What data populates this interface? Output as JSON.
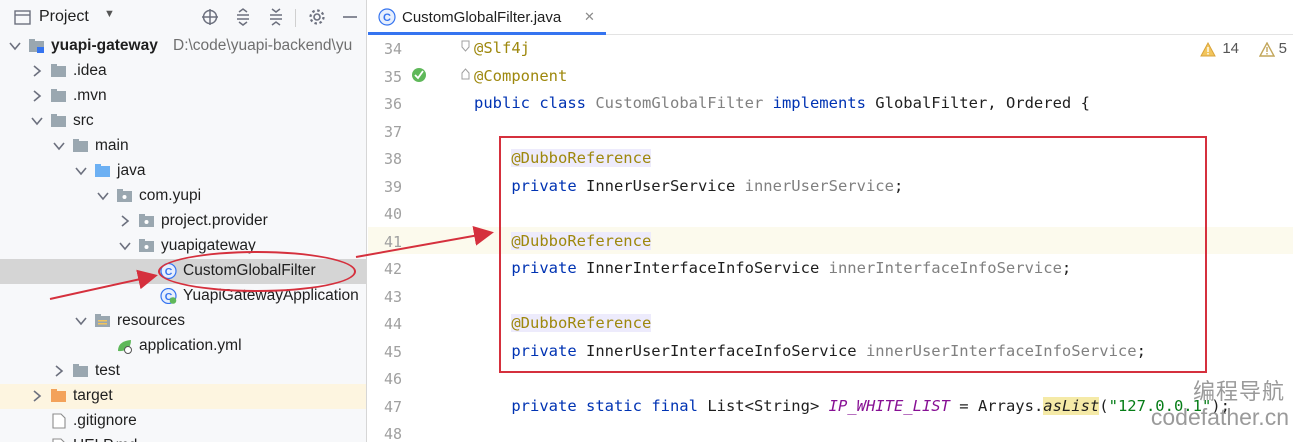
{
  "project_panel": {
    "title": "Project",
    "dropdown_glyph": "▼",
    "toolbar_icons": [
      "crosshair-icon",
      "expand-all-icon",
      "collapse-all-icon",
      "gear-icon",
      "minimize-icon"
    ],
    "tree": [
      {
        "label": "yuapi-gateway",
        "path": "D:\\code\\yuapi-backend\\yu",
        "bold": true,
        "icon": "module-folder-icon",
        "expanded": true
      },
      {
        "label": ".idea",
        "icon": "folder-icon",
        "expanded": false
      },
      {
        "label": ".mvn",
        "icon": "folder-icon",
        "expanded": false
      },
      {
        "label": "src",
        "icon": "folder-icon",
        "expanded": true
      },
      {
        "label": "main",
        "icon": "folder-icon",
        "expanded": true
      },
      {
        "label": "java",
        "icon": "source-folder-icon",
        "expanded": true
      },
      {
        "label": "com.yupi",
        "icon": "package-icon",
        "expanded": true
      },
      {
        "label": "project.provider",
        "icon": "package-icon",
        "expanded": false
      },
      {
        "label": "yuapigateway",
        "icon": "package-icon",
        "expanded": true
      },
      {
        "label": "CustomGlobalFilter",
        "icon": "class-icon",
        "selected": true
      },
      {
        "label": "YuapiGatewayApplication",
        "icon": "spring-class-icon"
      },
      {
        "label": "resources",
        "icon": "resources-folder-icon",
        "expanded": true
      },
      {
        "label": "application.yml",
        "icon": "yml-file-icon"
      },
      {
        "label": "test",
        "icon": "folder-icon",
        "expanded": false
      },
      {
        "label": "target",
        "icon": "excluded-folder-icon",
        "expanded": false
      },
      {
        "label": ".gitignore",
        "icon": "file-icon"
      },
      {
        "label": "HELP.md",
        "icon": "file-icon"
      }
    ]
  },
  "editor": {
    "tab_label": "CustomGlobalFilter.java",
    "tab_close": "✕",
    "inspection": {
      "warnings": "14",
      "weak_warnings": "5"
    },
    "lines": [
      {
        "num": "34",
        "tokens": [
          {
            "t": "@Slf4j",
            "c": "ann"
          }
        ]
      },
      {
        "num": "35",
        "tokens": [
          {
            "t": "@Component",
            "c": "ann"
          }
        ]
      },
      {
        "num": "36",
        "tokens": [
          {
            "t": "public ",
            "c": "kw"
          },
          {
            "t": "class ",
            "c": "kw"
          },
          {
            "t": "CustomGlobalFilter ",
            "c": "cls-gray"
          },
          {
            "t": "implements ",
            "c": "kw"
          },
          {
            "t": "GlobalFilter, Ordered {",
            "c": "type"
          }
        ]
      },
      {
        "num": "37",
        "tokens": []
      },
      {
        "num": "38",
        "tokens": [
          {
            "t": "    "
          },
          {
            "t": "@DubboReference",
            "c": "ann-hl"
          }
        ]
      },
      {
        "num": "39",
        "tokens": [
          {
            "t": "    "
          },
          {
            "t": "private ",
            "c": "kw"
          },
          {
            "t": "InnerUserService ",
            "c": "type"
          },
          {
            "t": "innerUserService",
            "c": "field-gray"
          },
          {
            "t": ";",
            "c": "type"
          }
        ]
      },
      {
        "num": "40",
        "tokens": []
      },
      {
        "num": "41",
        "tokens": [
          {
            "t": "    "
          },
          {
            "t": "@DubboReference",
            "c": "ann-hl"
          }
        ]
      },
      {
        "num": "42",
        "tokens": [
          {
            "t": "    "
          },
          {
            "t": "private ",
            "c": "kw"
          },
          {
            "t": "InnerInterfaceInfoService ",
            "c": "type"
          },
          {
            "t": "innerInterfaceInfoService",
            "c": "field-gray"
          },
          {
            "t": ";",
            "c": "type"
          }
        ]
      },
      {
        "num": "43",
        "tokens": []
      },
      {
        "num": "44",
        "tokens": [
          {
            "t": "    "
          },
          {
            "t": "@DubboReference",
            "c": "ann-hl"
          }
        ]
      },
      {
        "num": "45",
        "tokens": [
          {
            "t": "    "
          },
          {
            "t": "private ",
            "c": "kw"
          },
          {
            "t": "InnerUserInterfaceInfoService ",
            "c": "type"
          },
          {
            "t": "innerUserInterfaceInfoService",
            "c": "field-gray"
          },
          {
            "t": ";",
            "c": "type"
          }
        ]
      },
      {
        "num": "46",
        "tokens": []
      },
      {
        "num": "47",
        "tokens": [
          {
            "t": "    "
          },
          {
            "t": "private ",
            "c": "kw"
          },
          {
            "t": "static ",
            "c": "kw"
          },
          {
            "t": "final ",
            "c": "kw"
          },
          {
            "t": "List<String> ",
            "c": "type"
          },
          {
            "t": "IP_WHITE_LIST",
            "c": "field"
          },
          {
            "t": " = Arrays.",
            "c": "type"
          },
          {
            "t": "asList",
            "c": "method-italic"
          },
          {
            "t": "(",
            "c": "type"
          },
          {
            "t": "\"127.0.0.1\"",
            "c": "str"
          },
          {
            "t": ");",
            "c": "type"
          }
        ]
      },
      {
        "num": "48",
        "tokens": []
      }
    ]
  },
  "watermark": {
    "line1": "编程导航",
    "line2": "codefather.cn"
  },
  "colors": {
    "accent": "#3574f0",
    "annotation_red": "#d5303d",
    "keyword": "#0033b3",
    "annotation": "#9e880d",
    "string": "#067d17"
  }
}
